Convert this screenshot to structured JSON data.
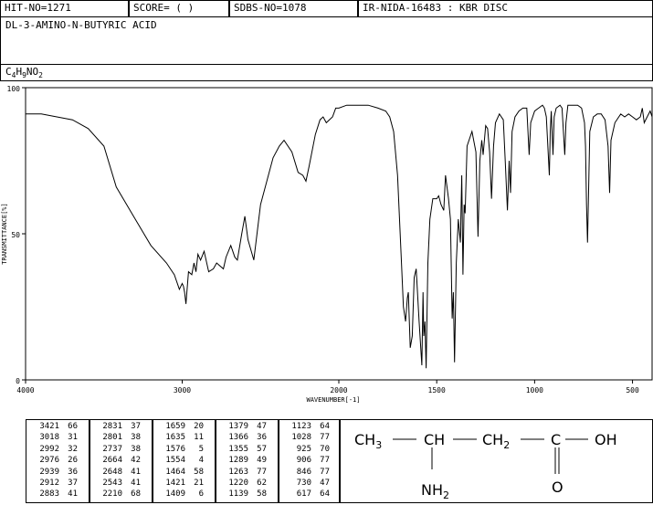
{
  "header": {
    "hit_no": "HIT-NO=1271",
    "score": "SCORE=  (   )",
    "sdbs_no": "SDBS-NO=1078",
    "ir_info": "IR-NIDA-16483 : KBR DISC"
  },
  "compound": {
    "name": "DL-3-AMINO-N-BUTYRIC ACID",
    "formula_c": "C",
    "formula_4": "4",
    "formula_h": "H",
    "formula_9": "9",
    "formula_n": "NO",
    "formula_2": "2"
  },
  "chart_data": {
    "type": "line",
    "title": "",
    "xlabel": "WAVENUMBER[-1]",
    "ylabel": "TRANSMITTANCE[%]",
    "xlim": [
      4000,
      400
    ],
    "ylim": [
      0,
      100
    ],
    "x_ticks": [
      "4000",
      "3000",
      "2000",
      "1500",
      "1000",
      "500"
    ],
    "y_ticks": [
      "100",
      "50",
      "0"
    ],
    "series": [
      {
        "points": [
          [
            4000,
            91
          ],
          [
            3900,
            91
          ],
          [
            3800,
            90
          ],
          [
            3700,
            89
          ],
          [
            3600,
            86
          ],
          [
            3500,
            80
          ],
          [
            3421,
            66
          ],
          [
            3300,
            55
          ],
          [
            3200,
            46
          ],
          [
            3100,
            40
          ],
          [
            3050,
            36
          ],
          [
            3018,
            31
          ],
          [
            3000,
            33
          ],
          [
            2992,
            32
          ],
          [
            2985,
            30
          ],
          [
            2976,
            26
          ],
          [
            2960,
            37
          ],
          [
            2939,
            36
          ],
          [
            2925,
            40
          ],
          [
            2912,
            37
          ],
          [
            2900,
            43
          ],
          [
            2883,
            41
          ],
          [
            2860,
            44
          ],
          [
            2831,
            37
          ],
          [
            2801,
            38
          ],
          [
            2780,
            40
          ],
          [
            2737,
            38
          ],
          [
            2720,
            42
          ],
          [
            2690,
            46
          ],
          [
            2664,
            42
          ],
          [
            2648,
            41
          ],
          [
            2620,
            50
          ],
          [
            2600,
            56
          ],
          [
            2580,
            48
          ],
          [
            2543,
            41
          ],
          [
            2500,
            60
          ],
          [
            2420,
            76
          ],
          [
            2380,
            80
          ],
          [
            2350,
            82
          ],
          [
            2300,
            78
          ],
          [
            2260,
            71
          ],
          [
            2230,
            70
          ],
          [
            2210,
            68
          ],
          [
            2190,
            73
          ],
          [
            2150,
            84
          ],
          [
            2120,
            89
          ],
          [
            2100,
            90
          ],
          [
            2080,
            88
          ],
          [
            2040,
            90
          ],
          [
            2020,
            93
          ],
          [
            2000,
            93
          ],
          [
            1960,
            94
          ],
          [
            1900,
            94
          ],
          [
            1850,
            94
          ],
          [
            1800,
            93
          ],
          [
            1760,
            92
          ],
          [
            1740,
            90
          ],
          [
            1720,
            85
          ],
          [
            1700,
            70
          ],
          [
            1680,
            40
          ],
          [
            1670,
            25
          ],
          [
            1659,
            20
          ],
          [
            1650,
            28
          ],
          [
            1645,
            30
          ],
          [
            1635,
            11
          ],
          [
            1625,
            15
          ],
          [
            1615,
            35
          ],
          [
            1605,
            38
          ],
          [
            1590,
            20
          ],
          [
            1576,
            5
          ],
          [
            1570,
            30
          ],
          [
            1566,
            15
          ],
          [
            1560,
            20
          ],
          [
            1554,
            4
          ],
          [
            1545,
            40
          ],
          [
            1535,
            55
          ],
          [
            1520,
            62
          ],
          [
            1500,
            62
          ],
          [
            1490,
            63
          ],
          [
            1478,
            60
          ],
          [
            1464,
            58
          ],
          [
            1455,
            70
          ],
          [
            1440,
            62
          ],
          [
            1430,
            55
          ],
          [
            1421,
            21
          ],
          [
            1415,
            30
          ],
          [
            1409,
            6
          ],
          [
            1400,
            40
          ],
          [
            1390,
            55
          ],
          [
            1379,
            47
          ],
          [
            1372,
            70
          ],
          [
            1366,
            36
          ],
          [
            1360,
            60
          ],
          [
            1355,
            57
          ],
          [
            1345,
            80
          ],
          [
            1320,
            85
          ],
          [
            1300,
            78
          ],
          [
            1289,
            49
          ],
          [
            1280,
            75
          ],
          [
            1270,
            82
          ],
          [
            1263,
            77
          ],
          [
            1250,
            87
          ],
          [
            1240,
            86
          ],
          [
            1230,
            78
          ],
          [
            1220,
            62
          ],
          [
            1210,
            80
          ],
          [
            1200,
            88
          ],
          [
            1180,
            91
          ],
          [
            1160,
            89
          ],
          [
            1150,
            75
          ],
          [
            1139,
            58
          ],
          [
            1130,
            75
          ],
          [
            1123,
            64
          ],
          [
            1115,
            85
          ],
          [
            1100,
            90
          ],
          [
            1080,
            92
          ],
          [
            1060,
            93
          ],
          [
            1040,
            93
          ],
          [
            1028,
            77
          ],
          [
            1020,
            88
          ],
          [
            1000,
            92
          ],
          [
            980,
            93
          ],
          [
            960,
            94
          ],
          [
            950,
            93
          ],
          [
            940,
            90
          ],
          [
            925,
            70
          ],
          [
            920,
            85
          ],
          [
            915,
            92
          ],
          [
            906,
            77
          ],
          [
            900,
            90
          ],
          [
            890,
            93
          ],
          [
            870,
            94
          ],
          [
            860,
            93
          ],
          [
            846,
            77
          ],
          [
            840,
            88
          ],
          [
            830,
            94
          ],
          [
            800,
            94
          ],
          [
            780,
            94
          ],
          [
            760,
            93
          ],
          [
            745,
            88
          ],
          [
            740,
            80
          ],
          [
            735,
            60
          ],
          [
            730,
            47
          ],
          [
            725,
            62
          ],
          [
            718,
            85
          ],
          [
            700,
            90
          ],
          [
            680,
            91
          ],
          [
            660,
            91
          ],
          [
            640,
            89
          ],
          [
            625,
            80
          ],
          [
            617,
            64
          ],
          [
            610,
            82
          ],
          [
            590,
            88
          ],
          [
            560,
            91
          ],
          [
            540,
            90
          ],
          [
            520,
            91
          ],
          [
            500,
            90
          ],
          [
            480,
            89
          ],
          [
            460,
            90
          ],
          [
            450,
            93
          ],
          [
            440,
            88
          ],
          [
            425,
            90
          ],
          [
            410,
            92
          ],
          [
            400,
            90
          ]
        ]
      }
    ]
  },
  "peaks": [
    [
      "3421",
      "66"
    ],
    [
      "3018",
      "31"
    ],
    [
      "2992",
      "32"
    ],
    [
      "2976",
      "26"
    ],
    [
      "2939",
      "36"
    ],
    [
      "2912",
      "37"
    ],
    [
      "2883",
      "41"
    ],
    [
      "2831",
      "37"
    ],
    [
      "2801",
      "38"
    ],
    [
      "2737",
      "38"
    ],
    [
      "2664",
      "42"
    ],
    [
      "2648",
      "41"
    ],
    [
      "2543",
      "41"
    ],
    [
      "2210",
      "68"
    ],
    [
      "1659",
      "20"
    ],
    [
      "1635",
      "11"
    ],
    [
      "1576",
      "5"
    ],
    [
      "1554",
      "4"
    ],
    [
      "1464",
      "58"
    ],
    [
      "1421",
      "21"
    ],
    [
      "1409",
      "6"
    ],
    [
      "1379",
      "47"
    ],
    [
      "1366",
      "36"
    ],
    [
      "1355",
      "57"
    ],
    [
      "1289",
      "49"
    ],
    [
      "1263",
      "77"
    ],
    [
      "1220",
      "62"
    ],
    [
      "1139",
      "58"
    ],
    [
      "1123",
      "64"
    ],
    [
      "1028",
      "77"
    ],
    [
      "925",
      "70"
    ],
    [
      "906",
      "77"
    ],
    [
      "846",
      "77"
    ],
    [
      "730",
      "47"
    ],
    [
      "617",
      "64"
    ]
  ],
  "structure": {
    "ch3": "CH",
    "ch3_sub": "3",
    "ch": "CH",
    "ch2": "CH",
    "ch2_sub": "2",
    "c": "C",
    "oh": "OH",
    "nh2": "NH",
    "nh2_sub": "2",
    "o": "O"
  }
}
